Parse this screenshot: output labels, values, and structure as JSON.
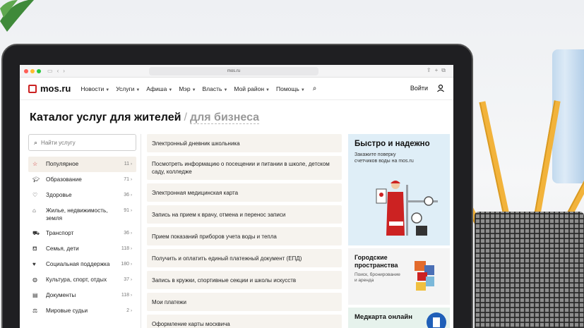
{
  "browser": {
    "address": "mos.ru"
  },
  "header": {
    "logo_text": "mos.ru",
    "nav": [
      {
        "label": "Новости",
        "has_menu": true
      },
      {
        "label": "Услуги",
        "has_menu": true
      },
      {
        "label": "Афиша",
        "has_menu": true
      },
      {
        "label": "Мэр",
        "has_menu": true
      },
      {
        "label": "Власть",
        "has_menu": true
      },
      {
        "label": "Мой район",
        "has_menu": true
      },
      {
        "label": "Помощь",
        "has_menu": true
      }
    ],
    "login_label": "Войти"
  },
  "page": {
    "title": "Каталог услуг для жителей",
    "separator": "/",
    "alt_title": "для бизнеса"
  },
  "sidebar": {
    "search_placeholder": "Найти услугу",
    "categories": [
      {
        "label": "Популярное",
        "count": "11",
        "icon": "star-icon",
        "active": true
      },
      {
        "label": "Образование",
        "count": "71",
        "icon": "graduation-cap-icon"
      },
      {
        "label": "Здоровье",
        "count": "36",
        "icon": "health-icon"
      },
      {
        "label": "Жилье, недвижимость, земля",
        "count": "91",
        "icon": "house-icon"
      },
      {
        "label": "Транспорт",
        "count": "36",
        "icon": "car-icon"
      },
      {
        "label": "Семья, дети",
        "count": "118",
        "icon": "sofa-icon"
      },
      {
        "label": "Социальная поддержка",
        "count": "180",
        "icon": "heart-hand-icon"
      },
      {
        "label": "Культура, спорт, отдых",
        "count": "37",
        "icon": "ball-icon"
      },
      {
        "label": "Документы",
        "count": "118",
        "icon": "document-icon"
      },
      {
        "label": "Мировые судьи",
        "count": "2",
        "icon": "scales-icon"
      }
    ]
  },
  "services": [
    "Электронный дневник школьника",
    "Посмотреть информацию о посещении и питании в школе, детском саду, колледже",
    "Электронная медицинская карта",
    "Запись на прием к врачу, отмена и перенос записи",
    "Прием показаний приборов учета воды и тепла",
    "Получить и оплатить единый платежный документ (ЕПД)",
    "Запись в кружки, спортивные секции и школы искусств",
    "Мои платежи",
    "Оформление карты москвича"
  ],
  "promos": {
    "first": {
      "title": "Быстро и надежно",
      "text": "Закажите поверку счетчиков воды на mos.ru"
    },
    "second": {
      "title": "Городские пространства",
      "text": "Поиск, бронирование и аренда"
    },
    "third": {
      "title": "Медкарта онлайн"
    }
  },
  "colors": {
    "brand_red": "#cc2222",
    "promo_blue": "#dfeef7",
    "service_bg": "#f6f3ee"
  }
}
